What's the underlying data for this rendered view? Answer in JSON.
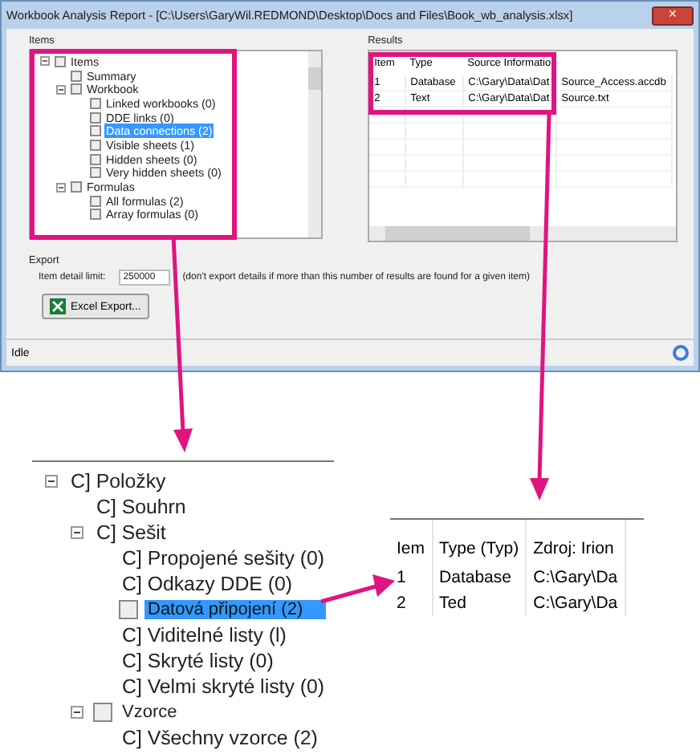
{
  "window": {
    "title": "Workbook Analysis Report - [C:\\Users\\GaryWil.REDMOND\\Desktop\\Docs and Files\\Book_wb_analysis.xlsx]",
    "close": "✕"
  },
  "items": {
    "label": "Items",
    "tree": [
      {
        "label": "Items",
        "checked": false,
        "selected": false,
        "expanded": true,
        "children": [
          {
            "label": "Summary",
            "checked": false,
            "selected": false
          },
          {
            "label": "Workbook",
            "checked": false,
            "selected": false,
            "expanded": true,
            "children": [
              {
                "label": "Linked workbooks (0)",
                "checked": false,
                "selected": false
              },
              {
                "label": "DDE links (0)",
                "checked": false,
                "selected": false
              },
              {
                "label": "Data connections (2)",
                "checked": false,
                "selected": true
              },
              {
                "label": "Visible sheets (1)",
                "checked": false,
                "selected": false
              },
              {
                "label": "Hidden sheets (0)",
                "checked": false,
                "selected": false
              },
              {
                "label": "Very hidden sheets (0)",
                "checked": false,
                "selected": false
              }
            ]
          },
          {
            "label": "Formulas",
            "checked": false,
            "selected": false,
            "expanded": true,
            "children": [
              {
                "label": "All formulas (2)",
                "checked": false,
                "selected": false
              },
              {
                "label": "Array formulas (0)",
                "checked": false,
                "selected": false
              }
            ]
          }
        ]
      }
    ]
  },
  "results": {
    "label": "Results",
    "columns": [
      "Item",
      "Type",
      "Source Informatio"
    ],
    "rows": [
      [
        "1",
        "Database",
        "C:\\Gary\\Data\\Dat",
        "Source_Access.accdb"
      ],
      [
        "2",
        "Text",
        "C:\\Gary\\Data\\Dat",
        "Source.txt"
      ]
    ]
  },
  "export": {
    "label": "Export",
    "limit_label": "Item detail limit:",
    "limit_value": "250000",
    "note": "(don't export details if more than this number of results are found for a given item)",
    "button": "Excel Export..."
  },
  "status_bar": {
    "text": "Idle"
  },
  "callout_tree": [
    {
      "label": "C] Položky",
      "kind": "text",
      "selected": false,
      "expanded": true,
      "children": [
        {
          "label": "C] Souhrn",
          "kind": "text",
          "selected": false
        },
        {
          "label": "C] Sešit",
          "kind": "text",
          "selected": false,
          "expanded": true,
          "children": [
            {
              "label": "C] Propojené sešity (0)",
              "kind": "text",
              "selected": false
            },
            {
              "label": "C] Odkazy DDE (0)",
              "kind": "text",
              "selected": false
            },
            {
              "label": "Datová připojení (2)",
              "kind": "checkbox",
              "checked": false,
              "selected": true
            },
            {
              "label": "C] Viditelné listy (l)",
              "kind": "text",
              "selected": false
            },
            {
              "label": "C] Skryté listy (0)",
              "kind": "text",
              "selected": false
            },
            {
              "label": "C] Velmi skryté listy (0)",
              "kind": "text",
              "selected": false
            }
          ]
        },
        {
          "label": "Vzorce",
          "kind": "checkbox",
          "checked": false,
          "selected": false,
          "expanded": true,
          "children": [
            {
              "label": "C] Všechny vzorce (2)",
              "kind": "text",
              "selected": false
            }
          ]
        }
      ]
    }
  ],
  "callout_table": {
    "columns": [
      "Iem",
      "Type (Typ)",
      "Zdroj: Irion"
    ],
    "rows": [
      [
        "1",
        "Database",
        "C:\\Gary\\Da"
      ],
      [
        "2",
        "Ted",
        "C:\\Gary\\Da"
      ]
    ]
  }
}
